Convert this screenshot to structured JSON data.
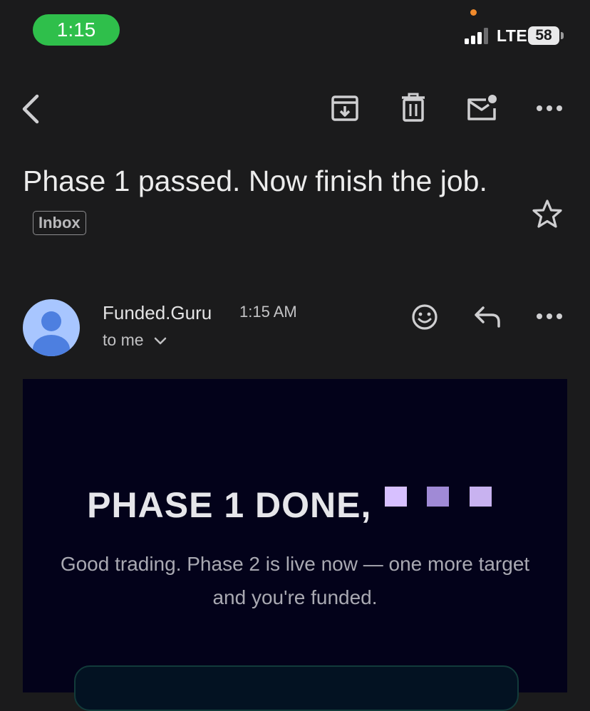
{
  "status_bar": {
    "time": "1:15",
    "network": "LTE",
    "battery": "58",
    "accent_color": "#2fbf4b"
  },
  "toolbar": {
    "icons": [
      "back-icon",
      "archive-icon",
      "delete-icon",
      "mark-unread-icon",
      "more-icon"
    ]
  },
  "email": {
    "subject": "Phase 1 passed. Now finish the job.",
    "label": "Inbox",
    "sender": "Funded.Guru",
    "time": "1:15 AM",
    "recipient": "to me"
  },
  "message": {
    "headline": "PHASE 1 DONE,",
    "intro": "Good trading. Phase 2 is live now — one more target and you're funded.",
    "background_color": "#03021a"
  }
}
